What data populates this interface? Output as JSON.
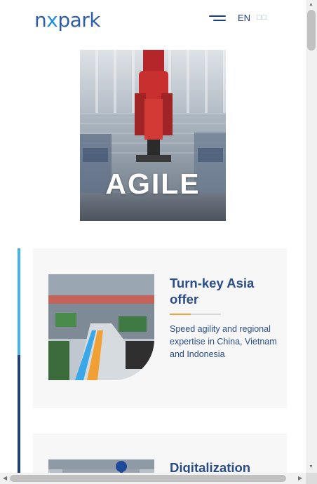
{
  "header": {
    "logo_text_a": "n",
    "logo_text_x": "x",
    "logo_text_b": "park",
    "lang_active": "EN",
    "lang_other": "□□",
    "menu_icon": "hamburger-menu-icon"
  },
  "hero": {
    "overlay_word": "AGILE"
  },
  "cards": [
    {
      "title": "Turn-key Asia offer",
      "description": "Speed agility and regional expertise in China, Vietnam and Indonesia"
    },
    {
      "title": "Digitalization"
    }
  ],
  "colors": {
    "brand_blue": "#2a4d8a",
    "accent_light_blue": "#45b2ea",
    "accent_orange": "#f2a33a",
    "card_bg": "#f7f7f7"
  }
}
